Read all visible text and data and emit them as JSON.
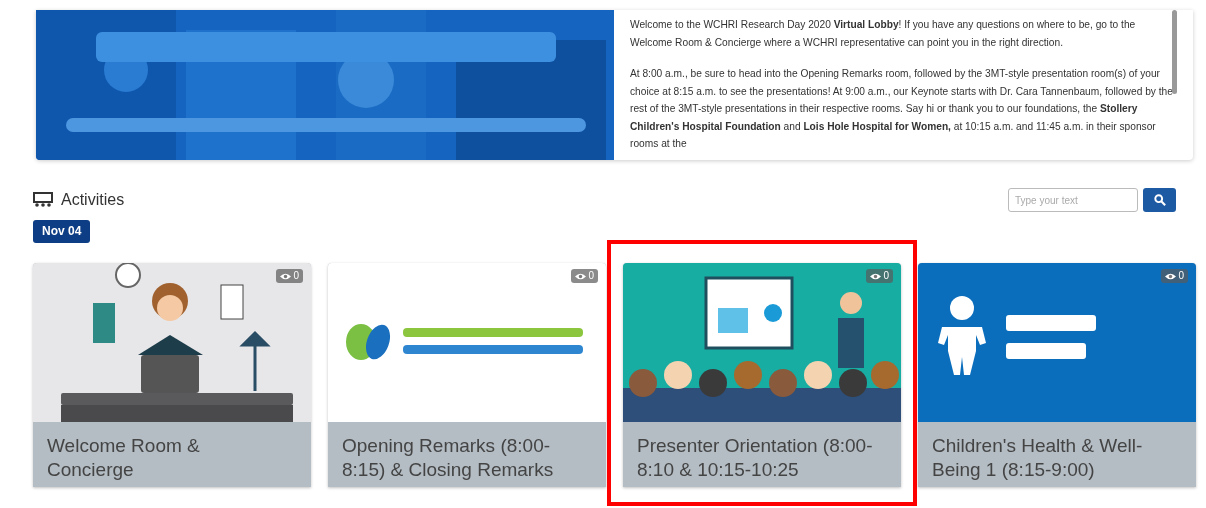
{
  "intro": {
    "paragraphs": [
      "Welcome to the WCHRI Research Day 2020 **Virtual Lobby**! If you have any questions on where to be, go to the Welcome Room & Concierge where a WCHRI representative can point you in the right direction.",
      "At 8:00 a.m., be sure to head into the Opening Remarks room, followed by the 3MT-style presentation room(s) of your choice at 8:15 a.m. to see the presentations! At 9:00 a.m., our Keynote starts with Dr. Cara Tannenbaum, followed by the rest of the 3MT-style presentations in their respective rooms. Say hi or thank you to our foundations, the **Stollery Children's Hospital Foundation** and **Lois Hole Hospital for Women,** at 10:15 a.m. and 11:45 a.m. in their sponsor rooms at the"
    ]
  },
  "activities": {
    "title": "Activities",
    "search": {
      "placeholder": "Type your text"
    },
    "date": "Nov 04",
    "cards": [
      {
        "views": "0",
        "title": "Welcome Room & Concierge",
        "highlighted": false
      },
      {
        "views": "0",
        "title": "Opening Remarks (8:00-8:15) & Closing Remarks",
        "highlighted": false
      },
      {
        "views": "0",
        "title": "Presenter Orientation (8:00-8:10 & 10:15-10:25",
        "highlighted": true
      },
      {
        "views": "0",
        "title": "Children's Health & Well-Being 1 (8:15-9:00)",
        "highlighted": false
      }
    ]
  }
}
